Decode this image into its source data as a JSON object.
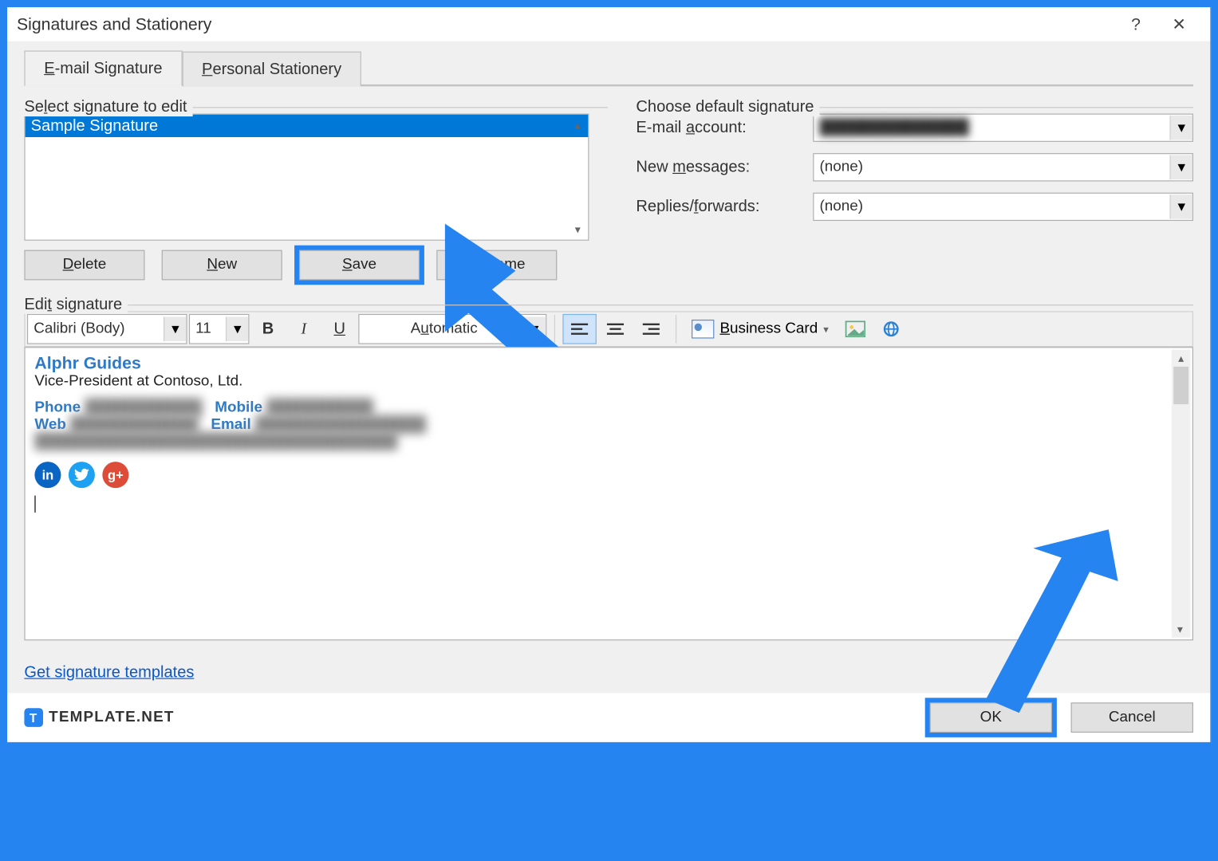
{
  "title": "Signatures and Stationery",
  "tabs": {
    "email": "E-mail Signature",
    "stationery": "Personal Stationery"
  },
  "left": {
    "group": "Select signature to edit",
    "list_item": "Sample Signature",
    "buttons": {
      "delete": "Delete",
      "new": "New",
      "save": "Save",
      "rename": "Rename"
    }
  },
  "right": {
    "group": "Choose default signature",
    "account_label": "E-mail account:",
    "account_value": "██████████████",
    "new_label": "New messages:",
    "new_value": "(none)",
    "reply_label": "Replies/forwards:",
    "reply_value": "(none)"
  },
  "edit_label": "Edit signature",
  "toolbar": {
    "font": "Calibri (Body)",
    "size": "11",
    "color": "Automatic",
    "bcard": "Business Card"
  },
  "signature": {
    "name": "Alphr Guides",
    "title": "Vice-President at Contoso, Ltd.",
    "phone_l": "Phone",
    "phone_v": "███████████",
    "mobile_l": "Mobile",
    "mobile_v": "██████████",
    "web_l": "Web",
    "web_v": "████████████",
    "email_l": "Email",
    "email_v": "████████████████",
    "addr": "██████████████████████████████████"
  },
  "link": "Get signature templates",
  "footer": {
    "brand": "TEMPLATE.NET",
    "ok": "OK",
    "cancel": "Cancel"
  }
}
